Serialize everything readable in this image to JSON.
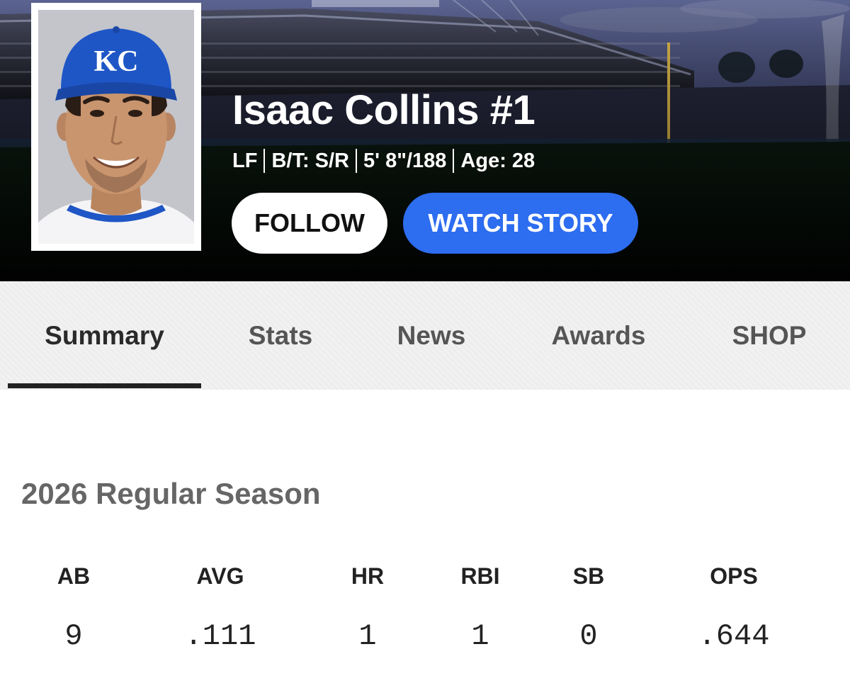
{
  "player": {
    "name": "Isaac Collins #1",
    "position": "LF",
    "bats_throws": "B/T: S/R",
    "height_weight": "5' 8\"/188",
    "age": "Age: 28",
    "cap_logo": "KC"
  },
  "buttons": {
    "follow_label": "FOLLOW",
    "watch_label": "WATCH STORY"
  },
  "tabs": [
    {
      "label": "Summary",
      "active": true
    },
    {
      "label": "Stats",
      "active": false
    },
    {
      "label": "News",
      "active": false
    },
    {
      "label": "Awards",
      "active": false
    },
    {
      "label": "SHOP",
      "active": false
    }
  ],
  "season": {
    "title": "2026 Regular Season",
    "stats": [
      {
        "label": "AB",
        "value": "9"
      },
      {
        "label": "AVG",
        "value": ".111"
      },
      {
        "label": "HR",
        "value": "1"
      },
      {
        "label": "RBI",
        "value": "1"
      },
      {
        "label": "SB",
        "value": "0"
      },
      {
        "label": "OPS",
        "value": ".644"
      }
    ]
  },
  "colors": {
    "accent_blue": "#2d6df0",
    "cap_blue": "#1f56c6",
    "tab_active_underline": "#222222"
  }
}
